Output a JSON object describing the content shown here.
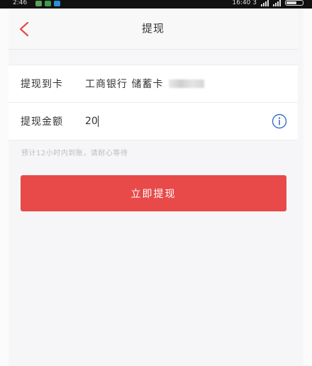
{
  "status_bar": {
    "time": "2:46",
    "right_text": "16:40 3",
    "app_colors": [
      "#5aa35a",
      "#3f9b4a",
      "#2a8fd6"
    ]
  },
  "nav": {
    "title": "提现",
    "back_icon": "chevron-left-icon"
  },
  "form": {
    "card_label": "提现到卡",
    "card_value": "工商银行 储蓄卡",
    "amount_label": "提现金额",
    "amount_value": "20",
    "info_icon": "info-circle-icon"
  },
  "hint": "预计12小时内到账，请耐心等待",
  "submit_label": "立即提现",
  "colors": {
    "accent": "#e84a4a",
    "info_blue": "#3b6fc9",
    "back_red": "#e84a4a"
  }
}
